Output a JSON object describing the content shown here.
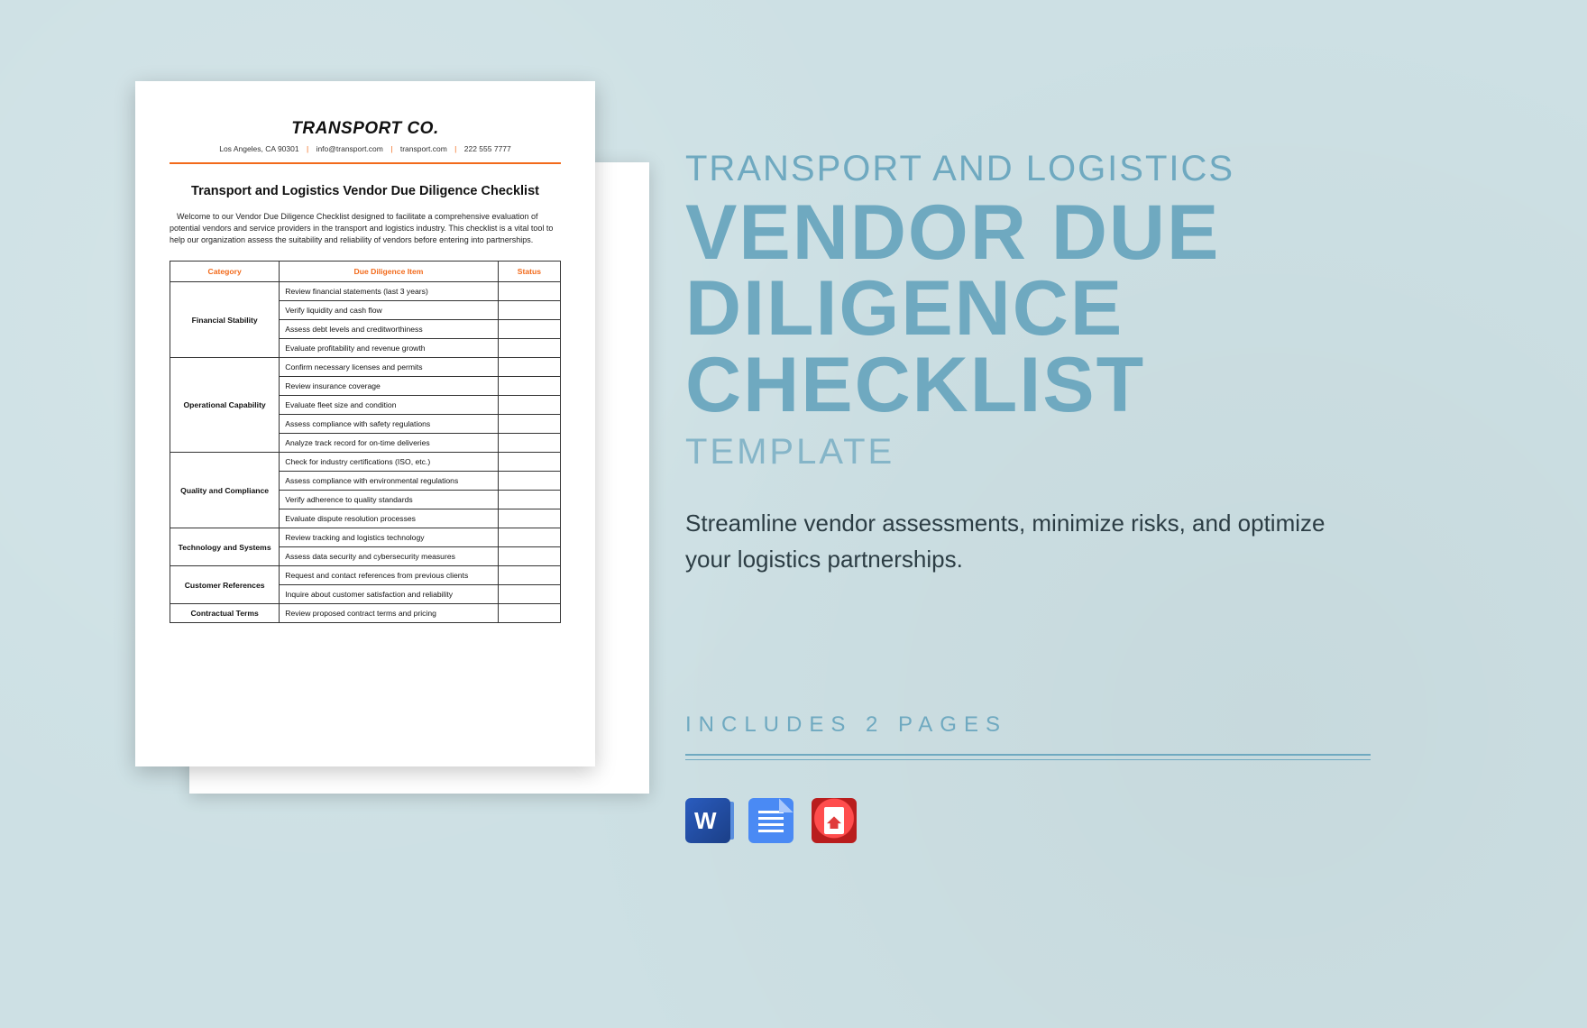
{
  "doc": {
    "company": "TRANSPORT CO.",
    "contact": {
      "address": "Los Angeles, CA 90301",
      "email": "info@transport.com",
      "site": "transport.com",
      "phone": "222 555 7777"
    },
    "title": "Transport and Logistics Vendor Due Diligence Checklist",
    "intro": "Welcome to our Vendor Due Diligence Checklist designed to facilitate a comprehensive evaluation of potential vendors and service providers in the transport and logistics industry. This checklist is a vital tool to help our organization assess the suitability and reliability of vendors before entering into partnerships.",
    "headers": {
      "c0": "Category",
      "c1": "Due Diligence Item",
      "c2": "Status"
    },
    "sections": [
      {
        "category": "Financial Stability",
        "items": [
          "Review financial statements (last 3 years)",
          "Verify liquidity and cash flow",
          "Assess debt levels and creditworthiness",
          "Evaluate profitability and revenue growth"
        ]
      },
      {
        "category": "Operational Capability",
        "items": [
          "Confirm necessary licenses and permits",
          "Review insurance coverage",
          "Evaluate fleet size and condition",
          "Assess compliance with safety regulations",
          "Analyze track record for on-time deliveries"
        ]
      },
      {
        "category": "Quality and Compliance",
        "items": [
          "Check for industry certifications (ISO, etc.)",
          "Assess compliance with environmental regulations",
          "Verify adherence to quality standards",
          "Evaluate dispute resolution processes"
        ]
      },
      {
        "category": "Technology and Systems",
        "items": [
          "Review tracking and logistics technology",
          "Assess data security and cybersecurity measures"
        ]
      },
      {
        "category": "Customer References",
        "items": [
          "Request and contact references from previous clients",
          "Inquire about customer satisfaction and reliability"
        ]
      },
      {
        "category": "Contractual Terms",
        "items": [
          "Review proposed contract terms and pricing"
        ]
      }
    ]
  },
  "promo": {
    "eyebrow": "TRANSPORT AND LOGISTICS",
    "headline": "VENDOR DUE DILIGENCE CHECKLIST",
    "subhead": "TEMPLATE",
    "blurb": "Streamline vendor assessments, minimize risks, and optimize your logistics partnerships.",
    "includes": "INCLUDES 2 PAGES"
  },
  "formats": {
    "word": "Word",
    "gdoc": "Google Docs",
    "pdf": "PDF"
  }
}
